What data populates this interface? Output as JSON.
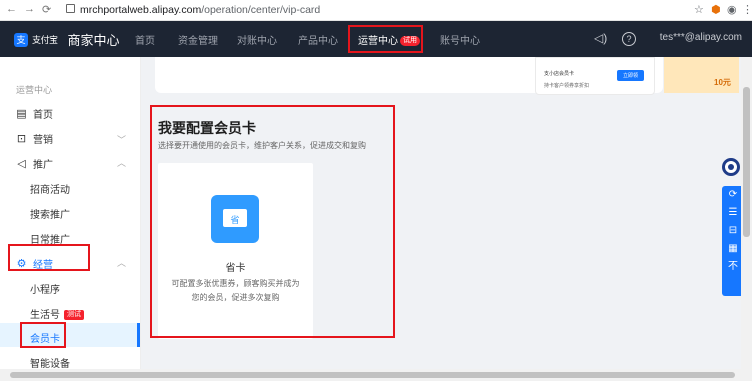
{
  "browser": {
    "back": "←",
    "forward": "→",
    "reload": "C",
    "url_host": "mrchportalweb.alipay.com",
    "url_path": "/operation/center/vip-card",
    "star": "☆",
    "menu": "⋮"
  },
  "topnav": {
    "logo_glyph": "支",
    "logo_text": "支付宝",
    "merchant_center": "商家中心",
    "items": [
      "首页",
      "资金管理",
      "对账中心",
      "产品中心",
      "运营中心",
      "账号中心"
    ],
    "active_index": 4,
    "active_badge": "试用",
    "email": "tes***@alipay.com"
  },
  "sidebar": {
    "section_title": "运营中心",
    "home": "首页",
    "marketing": "营销",
    "promotion": "推广",
    "promotion_subs": [
      "招商活动",
      "搜索推广",
      "日常推广"
    ],
    "operation": "经营",
    "operation_subs": [
      "小程序",
      "生活号",
      "会员卡",
      "智能设备"
    ],
    "test_tag": "测试",
    "selected": "会员卡"
  },
  "banner": {
    "card_title": "支小店会员卡",
    "card_sub": "持卡客户领券享折扣",
    "card_btn": "立即领",
    "gold_num": "10元"
  },
  "main": {
    "title": "我要配置会员卡",
    "description": "选择要开通使用的会员卡，维护客户关系，促进成交和复购",
    "card": {
      "icon_glyph": "省",
      "name": "省卡",
      "desc": "可配置多张优惠券，顾客购买并成为您的会员，促进多次复购"
    }
  },
  "tools": [
    "⟳",
    "☰",
    "⊟",
    "▦",
    "不"
  ],
  "colors": {
    "accent": "#1677ff",
    "nav_bg": "#1d2533",
    "highlight": "#e5151c"
  }
}
